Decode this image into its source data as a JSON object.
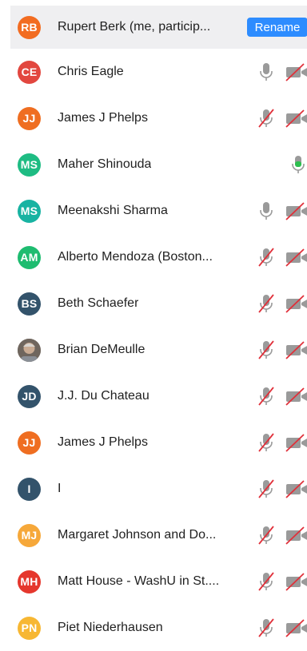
{
  "header_row": {
    "initials": "RB",
    "name": "Rupert Berk (me, particip...",
    "avatar_color": "#f26c21",
    "rename_label": "Rename"
  },
  "participants": [
    {
      "initials": "CE",
      "name": "Chris Eagle",
      "avatar_color": "#e2473f",
      "mic": "on",
      "video": "off"
    },
    {
      "initials": "JJ",
      "name": "James J Phelps",
      "avatar_color": "#ef6e21",
      "mic": "muted",
      "video": "off"
    },
    {
      "initials": "MS",
      "name": "Maher Shinouda",
      "avatar_color": "#1ebc83",
      "mic": "speaking",
      "video": "none"
    },
    {
      "initials": "MS",
      "name": "Meenakshi Sharma",
      "avatar_color": "#18b3a2",
      "mic": "on",
      "video": "off"
    },
    {
      "initials": "AM",
      "name": "Alberto Mendoza (Boston...",
      "avatar_color": "#1ebc70",
      "mic": "muted",
      "video": "off"
    },
    {
      "initials": "BS",
      "name": "Beth Schaefer",
      "avatar_color": "#33536b",
      "mic": "muted",
      "video": "off"
    },
    {
      "initials": "",
      "name": "Brian DeMeulle",
      "avatar_color": "#8a7d72",
      "photo": true,
      "mic": "muted",
      "video": "off"
    },
    {
      "initials": "JD",
      "name": "J.J. Du Chateau",
      "avatar_color": "#33536b",
      "mic": "muted",
      "video": "off"
    },
    {
      "initials": "JJ",
      "name": "James J Phelps",
      "avatar_color": "#ef6e21",
      "mic": "muted",
      "video": "off"
    },
    {
      "initials": "I",
      "name": "I",
      "avatar_color": "#33536b",
      "mic": "muted",
      "video": "off"
    },
    {
      "initials": "MJ",
      "name": "Margaret Johnson and Do...",
      "avatar_color": "#f6a83a",
      "mic": "muted",
      "video": "off"
    },
    {
      "initials": "MH",
      "name": "Matt House - WashU in St....",
      "avatar_color": "#e5372d",
      "mic": "muted",
      "video": "off"
    },
    {
      "initials": "PN",
      "name": "Piet Niederhausen",
      "avatar_color": "#f7b733",
      "mic": "muted",
      "video": "off"
    }
  ]
}
